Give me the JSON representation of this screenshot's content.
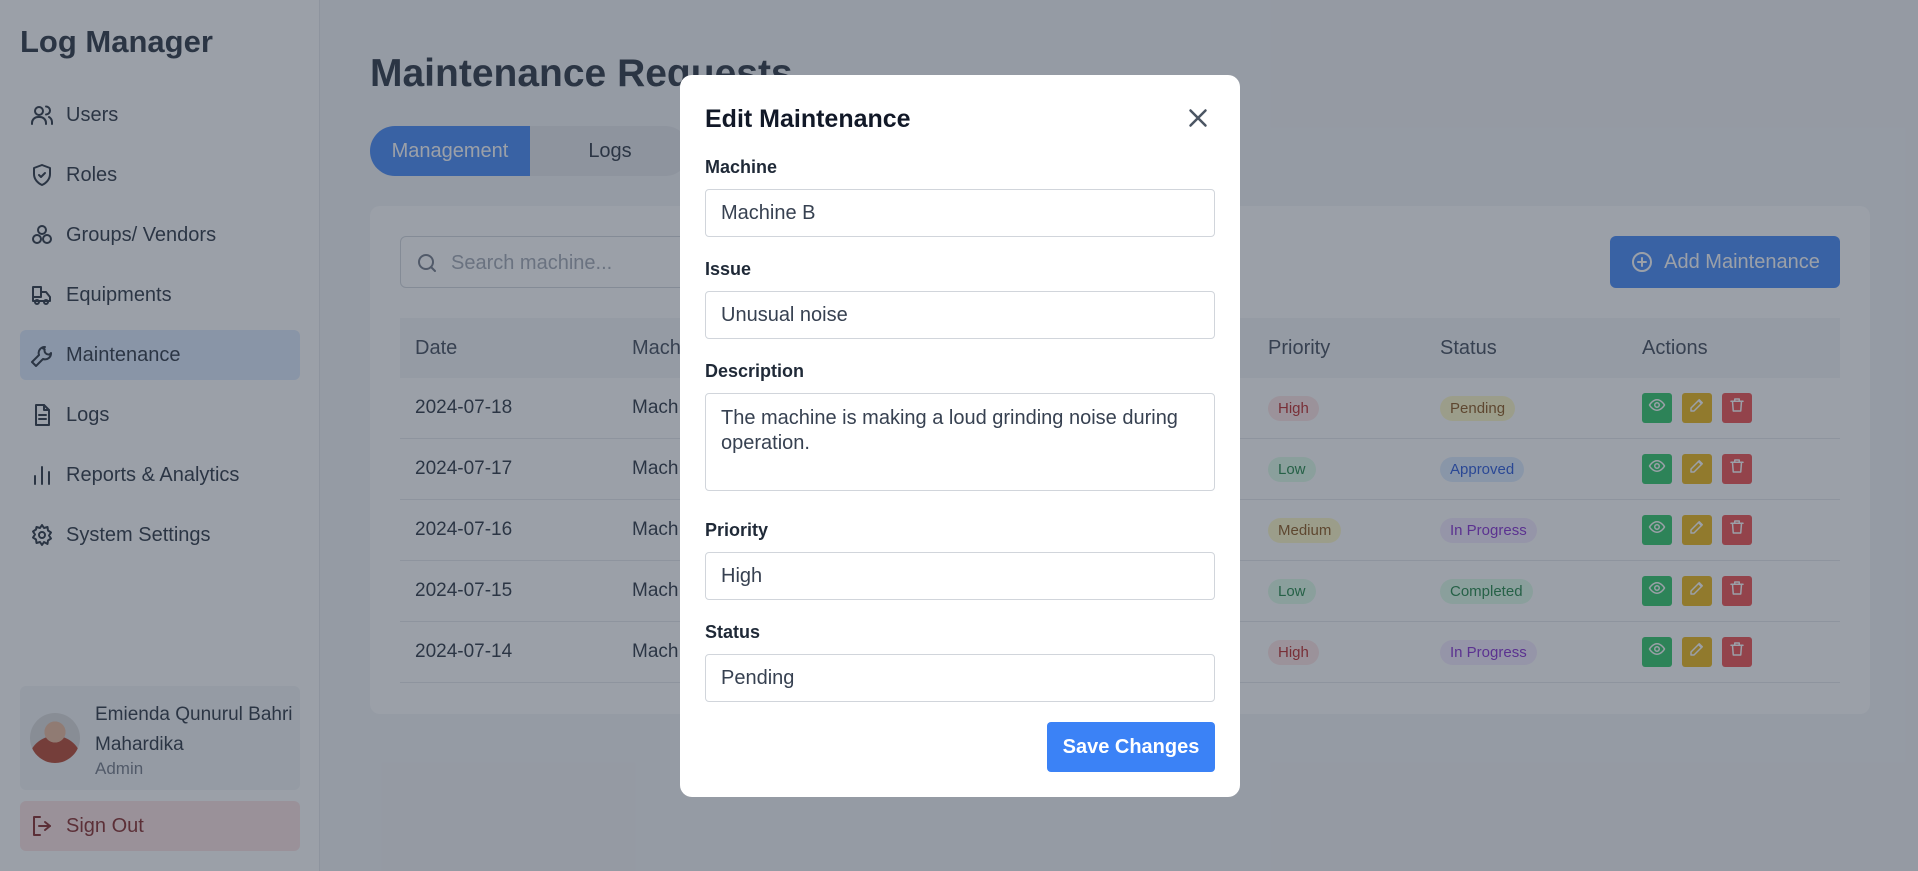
{
  "sidebar": {
    "brand": "Log Manager",
    "items": [
      {
        "label": "Users",
        "icon": "users-icon"
      },
      {
        "label": "Roles",
        "icon": "shield-icon"
      },
      {
        "label": "Groups/ Vendors",
        "icon": "groups-icon"
      },
      {
        "label": "Equipments",
        "icon": "equipment-icon"
      },
      {
        "label": "Maintenance",
        "icon": "wrench-icon",
        "active": true
      },
      {
        "label": "Logs",
        "icon": "file-icon"
      },
      {
        "label": "Reports & Analytics",
        "icon": "chart-icon"
      },
      {
        "label": "System Settings",
        "icon": "gear-icon"
      }
    ],
    "user": {
      "name": "Emienda Qunurul Bahri Mahardika",
      "role": "Admin"
    },
    "signout_label": "Sign Out"
  },
  "main": {
    "title": "Maintenance Requests",
    "tabs": [
      {
        "label": "Management",
        "active": true
      },
      {
        "label": "Logs",
        "active": false
      }
    ],
    "search_placeholder": "Search machine...",
    "add_button_label": "Add Maintenance",
    "table": {
      "columns": [
        "Date",
        "Machine",
        "Priority",
        "Status",
        "Actions"
      ],
      "rows": [
        {
          "date": "2024-07-18",
          "machine": "Mach",
          "priority": "High",
          "status": "Pending"
        },
        {
          "date": "2024-07-17",
          "machine": "Mach",
          "priority": "Low",
          "status": "Approved"
        },
        {
          "date": "2024-07-16",
          "machine": "Mach",
          "priority": "Medium",
          "status": "In Progress"
        },
        {
          "date": "2024-07-15",
          "machine": "Mach",
          "priority": "Low",
          "status": "Completed"
        },
        {
          "date": "2024-07-14",
          "machine": "Mach",
          "priority": "High",
          "status": "In Progress"
        }
      ]
    }
  },
  "modal": {
    "title": "Edit Maintenance",
    "machine_label": "Machine",
    "machine_value": "Machine B",
    "issue_label": "Issue",
    "issue_value": "Unusual noise",
    "description_label": "Description",
    "description_value": "The machine is making a loud grinding noise during operation.",
    "priority_label": "Priority",
    "priority_value": "High",
    "status_label": "Status",
    "status_value": "Pending",
    "save_label": "Save Changes"
  },
  "colors": {
    "accent": "#3b82f6",
    "active_nav": "#dbe8fd",
    "signout_bg": "#fde0e0",
    "priority": {
      "High": [
        "#fee2e2",
        "#b91c1c"
      ],
      "Low": [
        "#dcfce7",
        "#15803d"
      ],
      "Medium": [
        "#fef9c3",
        "#854d0e"
      ]
    },
    "status": {
      "Pending": [
        "#fef9c3",
        "#854d0e"
      ],
      "Approved": [
        "#dbeafe",
        "#1d4ed8"
      ],
      "In Progress": [
        "#f3e8ff",
        "#7e22ce"
      ],
      "Completed": [
        "#dcfce7",
        "#15803d"
      ]
    }
  }
}
